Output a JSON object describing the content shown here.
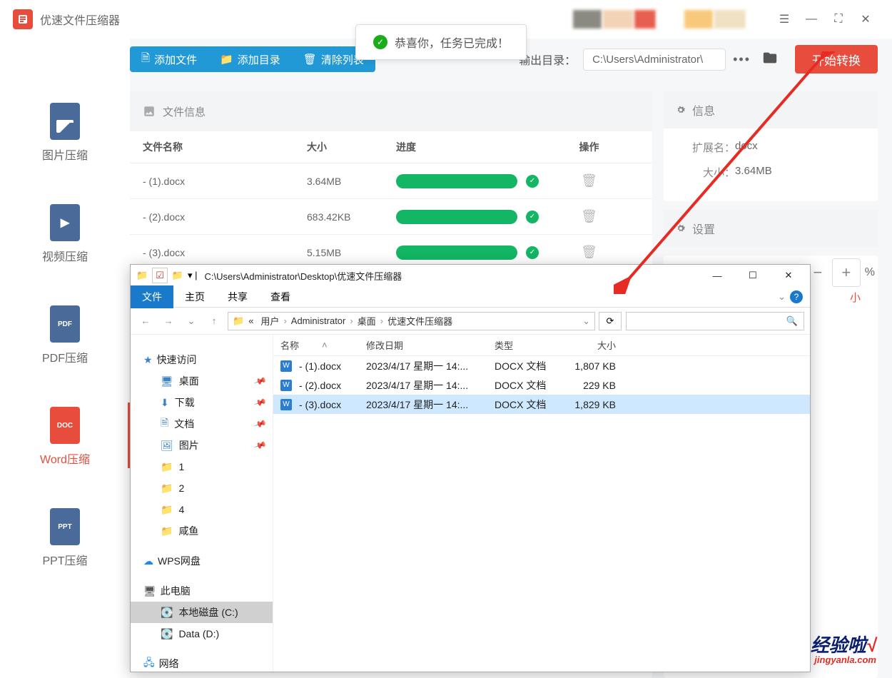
{
  "app": {
    "title": "优速文件压缩器"
  },
  "toast": "恭喜你，任务已完成！",
  "sidebar": [
    {
      "label": "图片压缩",
      "type": "img"
    },
    {
      "label": "视频压缩",
      "type": "vid"
    },
    {
      "label": "PDF压缩",
      "badge": "PDF"
    },
    {
      "label": "Word压缩",
      "badge": "DOC",
      "active": true
    },
    {
      "label": "PPT压缩",
      "badge": "PPT"
    }
  ],
  "toolbar": {
    "add_file": "添加文件",
    "add_dir": "添加目录",
    "clear": "清除列表",
    "out_label": "输出目录：",
    "out_path": "C:\\Users\\Administrator\\",
    "start": "开始转换"
  },
  "panel": {
    "file_info": "文件信息",
    "info": "信息",
    "settings": "设置",
    "cols": {
      "name": "文件名称",
      "size": "大小",
      "prog": "进度",
      "op": "操作"
    },
    "ext_label": "扩展名：",
    "ext_val": "docx",
    "size_label": "大小：",
    "size_val": "3.64MB",
    "pct": "%",
    "small_label": "小"
  },
  "files": [
    {
      "name": "- (1).docx",
      "size": "3.64MB"
    },
    {
      "name": "- (2).docx",
      "size": "683.42KB"
    },
    {
      "name": "- (3).docx",
      "size": "5.15MB"
    }
  ],
  "explorer": {
    "title_path": "C:\\Users\\Administrator\\Desktop\\优速文件压缩器",
    "tabs": {
      "file": "文件",
      "home": "主页",
      "share": "共享",
      "view": "查看"
    },
    "crumbs": [
      "«",
      "用户",
      "Administrator",
      "桌面",
      "优速文件压缩器"
    ],
    "side": {
      "quick": "快速访问",
      "desktop": "桌面",
      "download": "下载",
      "docs": "文档",
      "pics": "图片",
      "f1": "1",
      "f2": "2",
      "f4": "4",
      "fx": "咸鱼",
      "wps": "WPS网盘",
      "pc": "此电脑",
      "cdisk": "本地磁盘 (C:)",
      "ddisk": "Data (D:)",
      "net": "网络"
    },
    "cols": {
      "name": "名称",
      "date": "修改日期",
      "type": "类型",
      "size": "大小"
    },
    "rows": [
      {
        "name": "- (1).docx",
        "date": "2023/4/17 星期一 14:...",
        "type": "DOCX 文档",
        "size": "1,807 KB"
      },
      {
        "name": "- (2).docx",
        "date": "2023/4/17 星期一 14:...",
        "type": "DOCX 文档",
        "size": "229 KB"
      },
      {
        "name": "- (3).docx",
        "date": "2023/4/17 星期一 14:...",
        "type": "DOCX 文档",
        "size": "1,829 KB",
        "selected": true
      }
    ]
  },
  "watermark": {
    "cn": "经验啦",
    "en": "jingyanla.com"
  }
}
